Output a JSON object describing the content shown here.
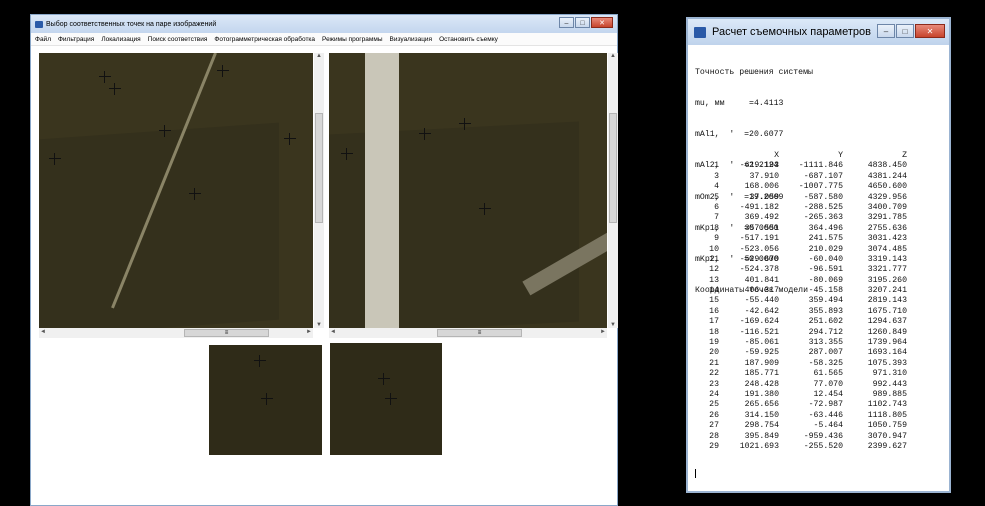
{
  "left_window": {
    "title": "Выбор соответственных точек на паре изображений",
    "controls": {
      "minimize": "–",
      "maximize": "□",
      "close": "✕"
    },
    "menu": [
      "Файл",
      "Фильтрация",
      "Локализация",
      "Поиск соответствия",
      "Фотограмметрическая обработка",
      "Режимы программы",
      "Визуализация",
      "Остановить съемку"
    ],
    "scroll_grip": "≡",
    "arrows": {
      "up": "▲",
      "down": "▼",
      "left": "◄",
      "right": "►"
    },
    "icon": "app-window-icon"
  },
  "right_window": {
    "title": "Расчет съемочных параметров",
    "controls": {
      "minimize": "–",
      "maximize": "□",
      "close": "✕"
    },
    "icon": "app-window-icon",
    "lines": [
      "Точность решения системы",
      "mu, мм     =4.4113",
      "mAl1,  '  =20.6077",
      "mAl2,  '  =2.2124",
      "mOm2,  '  =19.2009",
      "mKp1,  '  =0.0000",
      "mKp2,  '  =0.0000",
      "Координаты точек модели"
    ],
    "table_header": [
      "",
      "X",
      "Y",
      "Z"
    ],
    "table_rows": [
      [
        "1",
        "-619.193",
        "-1111.846",
        "4838.450"
      ],
      [
        "3",
        "37.910",
        "-687.107",
        "4381.244"
      ],
      [
        "4",
        "168.006",
        "-1007.775",
        "4650.600"
      ],
      [
        "5",
        "37.059",
        "-587.580",
        "4329.956"
      ],
      [
        "6",
        "-491.182",
        "-288.525",
        "3400.709"
      ],
      [
        "7",
        "369.492",
        "-265.363",
        "3291.785"
      ],
      [
        "8",
        "357.551",
        "364.496",
        "2755.636"
      ],
      [
        "9",
        "-517.191",
        "241.575",
        "3031.423"
      ],
      [
        "10",
        "-523.056",
        "210.029",
        "3074.485"
      ],
      [
        "11",
        "-529.670",
        "-60.040",
        "3319.143"
      ],
      [
        "12",
        "-524.378",
        "-96.591",
        "3321.777"
      ],
      [
        "13",
        "401.841",
        "-80.069",
        "3195.260"
      ],
      [
        "14",
        "406.317",
        "-45.158",
        "3207.241"
      ],
      [
        "15",
        "-55.440",
        "359.494",
        "2819.143"
      ],
      [
        "16",
        "-42.642",
        "355.893",
        "1675.710"
      ],
      [
        "17",
        "-169.624",
        "251.602",
        "1294.637"
      ],
      [
        "18",
        "-116.521",
        "294.712",
        "1260.849"
      ],
      [
        "19",
        "-85.061",
        "313.355",
        "1739.964"
      ],
      [
        "20",
        "-59.925",
        "287.007",
        "1693.164"
      ],
      [
        "21",
        "187.909",
        "-58.325",
        "1075.393"
      ],
      [
        "22",
        "185.771",
        "61.565",
        "971.310"
      ],
      [
        "23",
        "248.428",
        "77.070",
        "992.443"
      ],
      [
        "24",
        "191.380",
        "12.454",
        "989.885"
      ],
      [
        "25",
        "265.656",
        "-72.987",
        "1102.743"
      ],
      [
        "26",
        "314.150",
        "-63.446",
        "1118.805"
      ],
      [
        "27",
        "298.754",
        "-5.464",
        "1050.759"
      ],
      [
        "28",
        "395.849",
        "-959.436",
        "3070.947"
      ],
      [
        "29",
        "1021.693",
        "-255.520",
        "2399.627"
      ]
    ]
  },
  "colors": {
    "photo": "#3a351e",
    "titlebar": "#c8dbf1",
    "close": "#c7442c"
  }
}
